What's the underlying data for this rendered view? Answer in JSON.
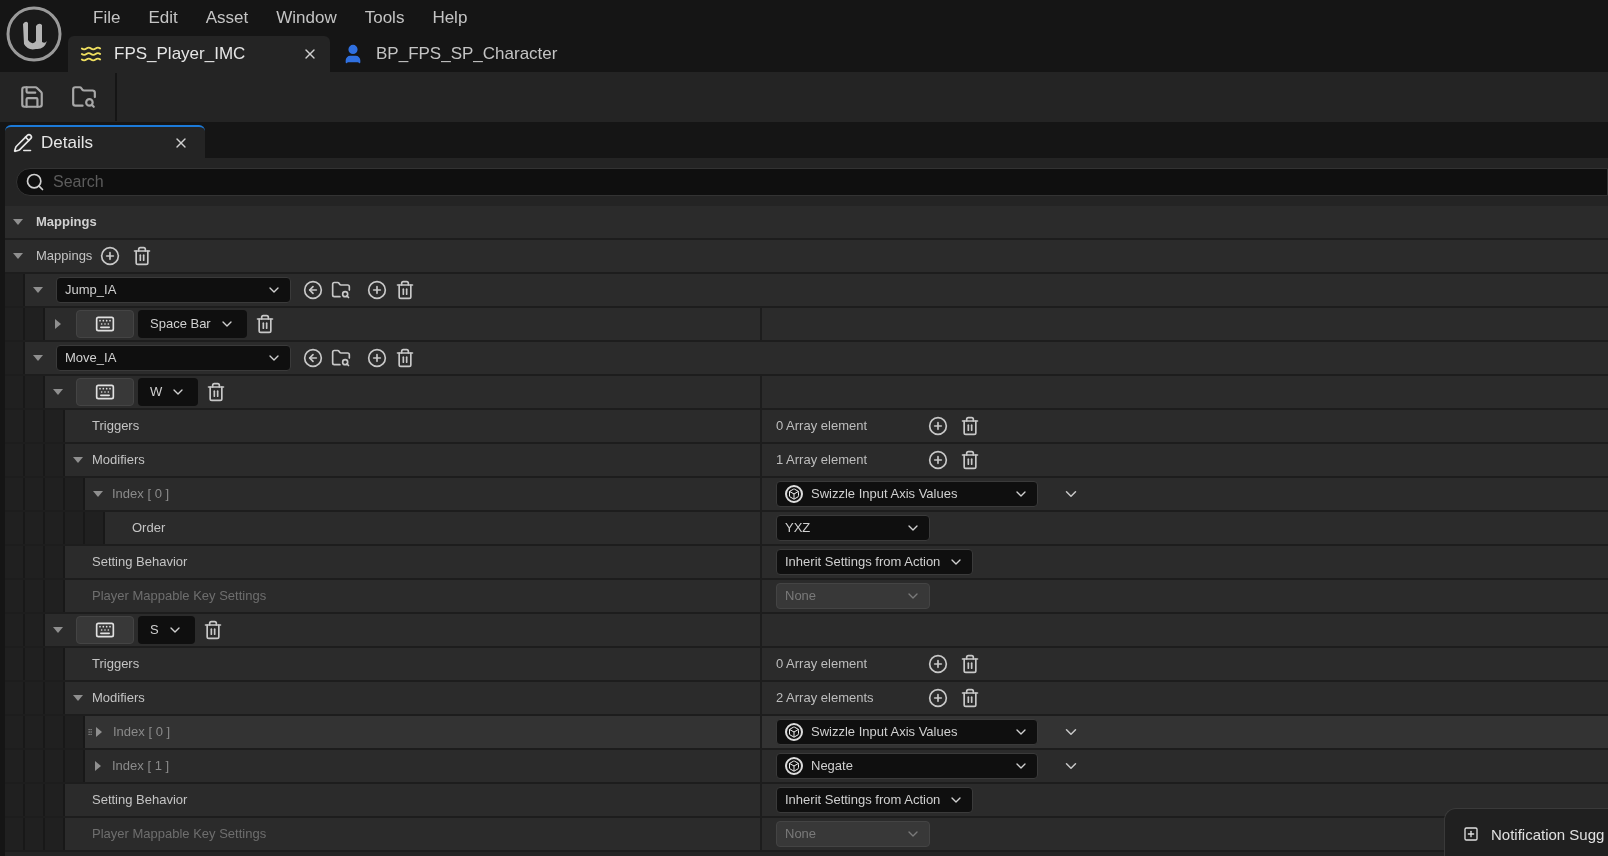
{
  "menu": [
    "File",
    "Edit",
    "Asset",
    "Window",
    "Tools",
    "Help"
  ],
  "tabs": [
    {
      "label": "FPS_Player_IMC",
      "selected": true,
      "kind": "mapping"
    },
    {
      "label": "BP_FPS_SP_Character",
      "selected": false,
      "kind": "blueprint"
    }
  ],
  "panel": {
    "title": "Details"
  },
  "search": {
    "placeholder": "Search"
  },
  "category": {
    "label": "Mappings",
    "expanded": true
  },
  "mappings": {
    "label": "Mappings",
    "expanded": true,
    "items": [
      {
        "action": "Jump_IA",
        "expanded": true,
        "keys": [
          {
            "key": "Space Bar",
            "expanded": false
          }
        ]
      },
      {
        "action": "Move_IA",
        "expanded": true,
        "keys": [
          {
            "key": "W",
            "expanded": true,
            "properties": [
              {
                "kind": "array",
                "label": "Triggers",
                "value": "0 Array element"
              },
              {
                "kind": "array",
                "label": "Modifiers",
                "value": "1 Array element",
                "expanded": true,
                "children": [
                  {
                    "kind": "modifier",
                    "label": "Index [ 0 ]",
                    "value": "Swizzle Input Axis Values",
                    "expanded": true,
                    "highlighted": false,
                    "children": [
                      {
                        "kind": "enum",
                        "label": "Order",
                        "value": "YXZ",
                        "disabled": false
                      }
                    ]
                  }
                ]
              },
              {
                "kind": "enum",
                "label": "Setting Behavior",
                "value": "Inherit Settings from Action",
                "disabled": false
              },
              {
                "kind": "enum",
                "label": "Player Mappable Key Settings",
                "value": "None",
                "disabled": true
              }
            ]
          },
          {
            "key": "S",
            "expanded": true,
            "properties": [
              {
                "kind": "array",
                "label": "Triggers",
                "value": "0 Array element"
              },
              {
                "kind": "array",
                "label": "Modifiers",
                "value": "2 Array elements",
                "expanded": true,
                "children": [
                  {
                    "kind": "modifier",
                    "label": "Index [ 0 ]",
                    "value": "Swizzle Input Axis Values",
                    "expanded": false,
                    "highlighted": true
                  },
                  {
                    "kind": "modifier",
                    "label": "Index [ 1 ]",
                    "value": "Negate",
                    "expanded": false,
                    "highlighted": false
                  }
                ]
              },
              {
                "kind": "enum",
                "label": "Setting Behavior",
                "value": "Inherit Settings from Action",
                "disabled": false
              },
              {
                "kind": "enum",
                "label": "Player Mappable Key Settings",
                "value": "None",
                "disabled": true
              }
            ]
          }
        ]
      }
    ]
  },
  "notification": {
    "text": "Notification Sugg"
  }
}
